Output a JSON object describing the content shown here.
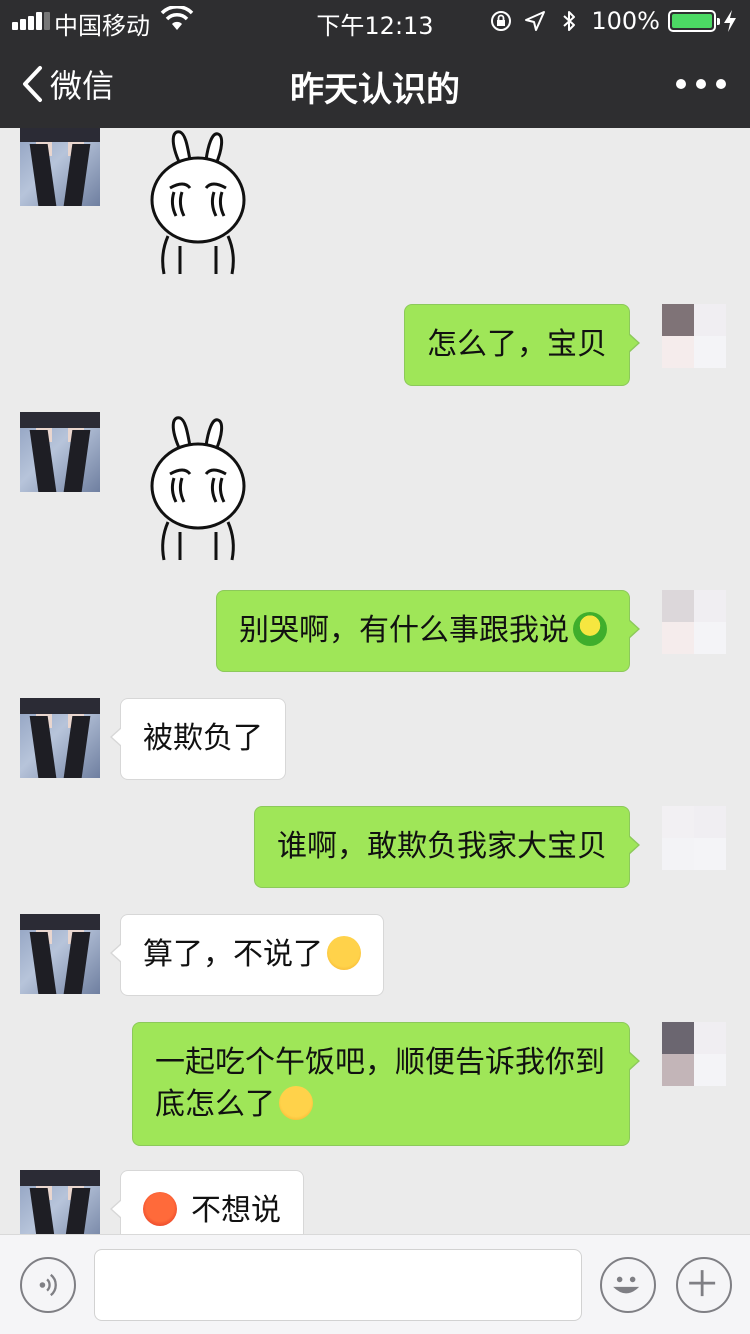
{
  "status": {
    "carrier": "中国移动",
    "time": "下午12:13",
    "battery_percent": "100%",
    "battery_level": 1.0
  },
  "nav": {
    "back_label": "微信",
    "title": "昨天认识的"
  },
  "messages": [
    {
      "side": "left",
      "type": "sticker",
      "sticker": "crying-rabbit"
    },
    {
      "side": "right",
      "type": "text",
      "text": "怎么了，宝贝"
    },
    {
      "side": "left",
      "type": "sticker",
      "sticker": "crying-rabbit"
    },
    {
      "side": "right",
      "type": "text",
      "text": "别哭啊，有什么事跟我说",
      "trailing_emoji": "green-frog-emoji"
    },
    {
      "side": "left",
      "type": "text",
      "text": "被欺负了"
    },
    {
      "side": "right",
      "type": "text",
      "text": "谁啊，敢欺负我家大宝贝"
    },
    {
      "side": "left",
      "type": "text",
      "text": "算了，不说了",
      "trailing_emoji": "unamused-face-emoji"
    },
    {
      "side": "right",
      "type": "text",
      "text": "一起吃个午饭吧，顺便告诉我你到底怎么了",
      "trailing_emoji": "kissing-face-emoji"
    },
    {
      "side": "left",
      "type": "text",
      "text": "不想说",
      "leading_emoji": "angry-face-emoji"
    }
  ],
  "input": {
    "value": "",
    "placeholder": ""
  },
  "colors": {
    "nav_bg": "#2e2e30",
    "chat_bg": "#ebebeb",
    "outgoing_bubble": "#9fe658",
    "incoming_bubble": "#ffffff",
    "battery_green": "#4cd964"
  }
}
